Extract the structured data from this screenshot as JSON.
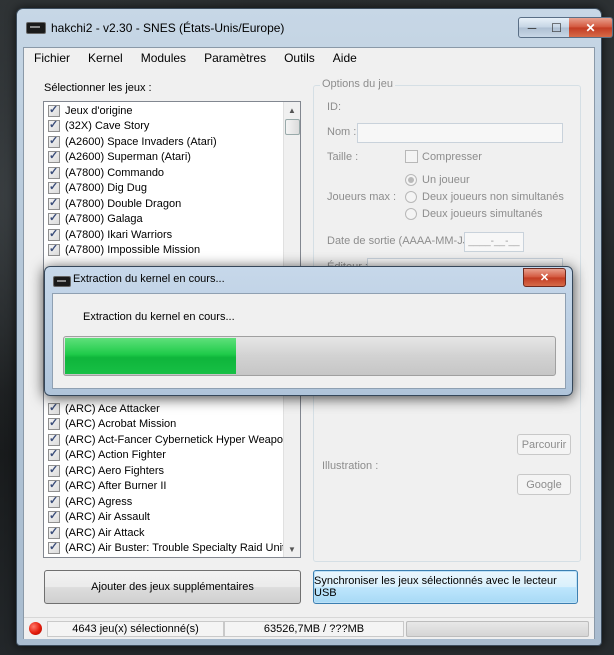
{
  "window": {
    "title": "hakchi2 - v2.30 - SNES (États-Unis/Europe)"
  },
  "menu": [
    "Fichier",
    "Kernel",
    "Modules",
    "Paramètres",
    "Outils",
    "Aide"
  ],
  "games_label": "Sélectionner les jeux :",
  "games_top": [
    "Jeux d'origine",
    "(32X) Cave Story",
    "(A2600) Space Invaders (Atari)",
    "(A2600) Superman (Atari)",
    "(A7800) Commando",
    "(A7800) Dig Dug",
    "(A7800) Double Dragon",
    "(A7800) Galaga",
    "(A7800) Ikari Warriors",
    "(A7800) Impossible Mission"
  ],
  "games_bottom": [
    "(ARC) Ace Attacker",
    "(ARC) Acrobat Mission",
    "(ARC) Act-Fancer Cybernetick Hyper Weapon",
    "(ARC) Action Fighter",
    "(ARC) Aero Fighters",
    "(ARC) After Burner II",
    "(ARC) Agress",
    "(ARC) Air Assault",
    "(ARC) Air Attack",
    "(ARC) Air Buster: Trouble Specialty Raid Unit"
  ],
  "options": {
    "title": "Options du jeu",
    "id_label": "ID:",
    "name_label": "Nom :",
    "size_label": "Taille :",
    "compress_label": "Compresser",
    "players_label": "Joueurs max :",
    "player_options": [
      "Un joueur",
      "Deux joueurs non simultanés",
      "Deux joueurs simultanés"
    ],
    "release_label": "Date de sortie (AAAA-MM-JJ) :",
    "release_value": "____-__-__",
    "publisher_label": "Éditeur :",
    "browse_button": "Parcourir",
    "illustration_label": "Illustration :",
    "google_button": "Google"
  },
  "buttons": {
    "add_games": "Ajouter des jeux supplémentaires",
    "sync": "Synchroniser les jeux sélectionnés avec le lecteur USB"
  },
  "status": {
    "selected": "4643 jeu(x) sélectionné(s)",
    "size": "63526,7MB / ???MB"
  },
  "dialog": {
    "title": "Extraction du kernel en cours...",
    "message": "Extraction du kernel en cours...",
    "progress": 0.35,
    "close_glyph": "✕"
  },
  "colors": {
    "progress_green": "#1fcb4a",
    "status_red": "#e41b0b"
  },
  "icons": {
    "minimize": "─",
    "maximize": "☐",
    "close": "✕",
    "scroll_up": "▲",
    "scroll_down": "▼"
  }
}
